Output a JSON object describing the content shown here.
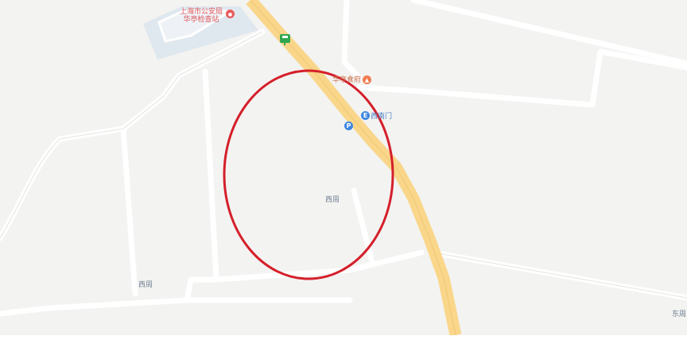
{
  "map": {
    "poi": {
      "line1": "上海市公安局",
      "line2": "华亭检查站",
      "icon": "location-pin-icon",
      "color": "#e85c5e"
    },
    "restaurant": {
      "label": "华亭食府",
      "icon": "restaurant-icon",
      "color": "#ef7d50"
    },
    "gate": {
      "label": "西南门",
      "icon": "entrance-icon",
      "color": "#3d86e0"
    },
    "parking": {
      "glyph": "P",
      "icon": "parking-icon",
      "color": "#3d86e0"
    },
    "bus_stop": {
      "icon": "bus-stop-icon",
      "color": "#2fa84f"
    },
    "pin_glyphs": {
      "poi": "●",
      "restaurant": "▲",
      "gate": "E"
    },
    "places": {
      "xizhou_center": "西周",
      "xizhou_left": "西周",
      "dongzhou": "东周"
    },
    "highlight_circle_color": "#d51f2a",
    "main_road_color": "#f9d68a"
  }
}
